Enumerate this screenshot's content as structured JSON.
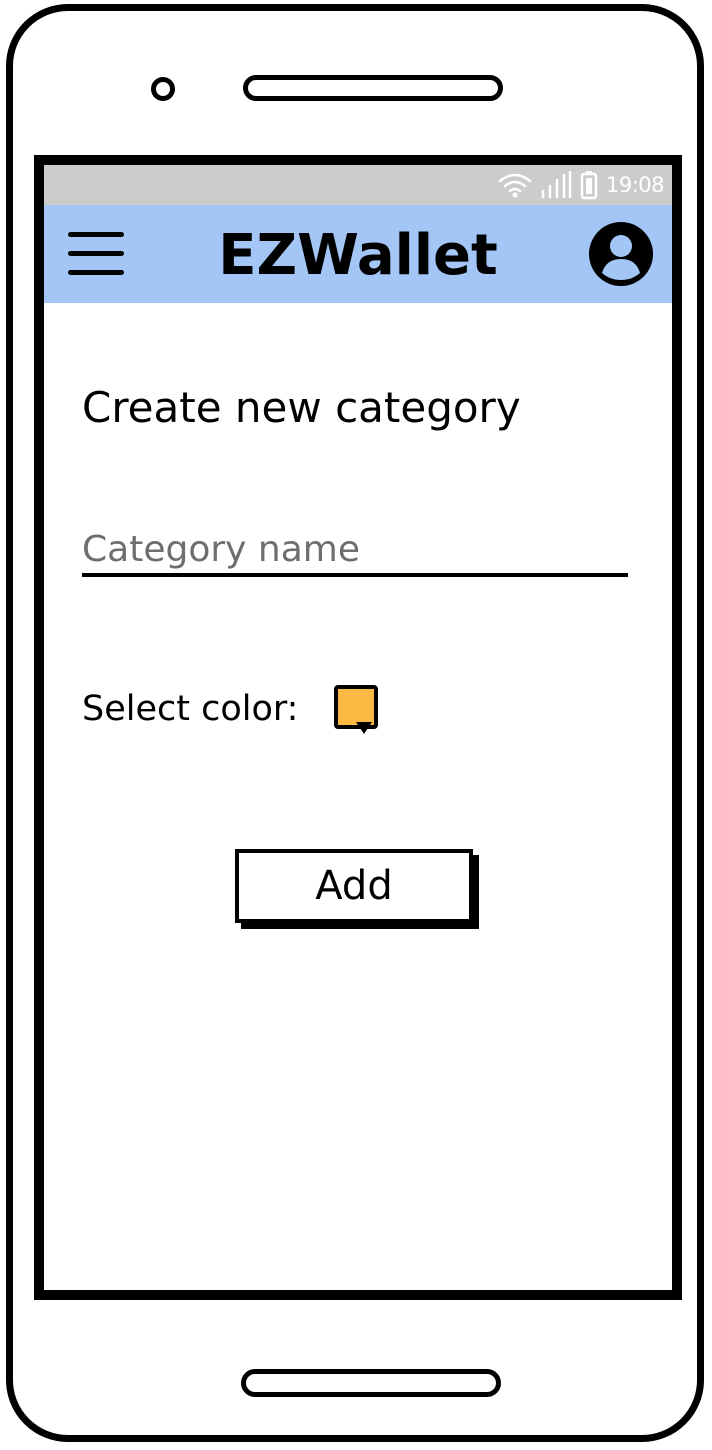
{
  "status_bar": {
    "time": "19:08",
    "icons": [
      "wifi-icon",
      "signal-icon",
      "battery-icon"
    ]
  },
  "app_bar": {
    "title": "EZWallet",
    "menu_icon": "hamburger-menu-icon",
    "profile_icon": "account-circle-icon",
    "background": "#a3c6f7"
  },
  "form": {
    "heading": "Create new category",
    "name_placeholder": "Category name",
    "name_value": "",
    "color_label": "Select color:",
    "color_value": "#fbb943",
    "add_label": "Add"
  }
}
